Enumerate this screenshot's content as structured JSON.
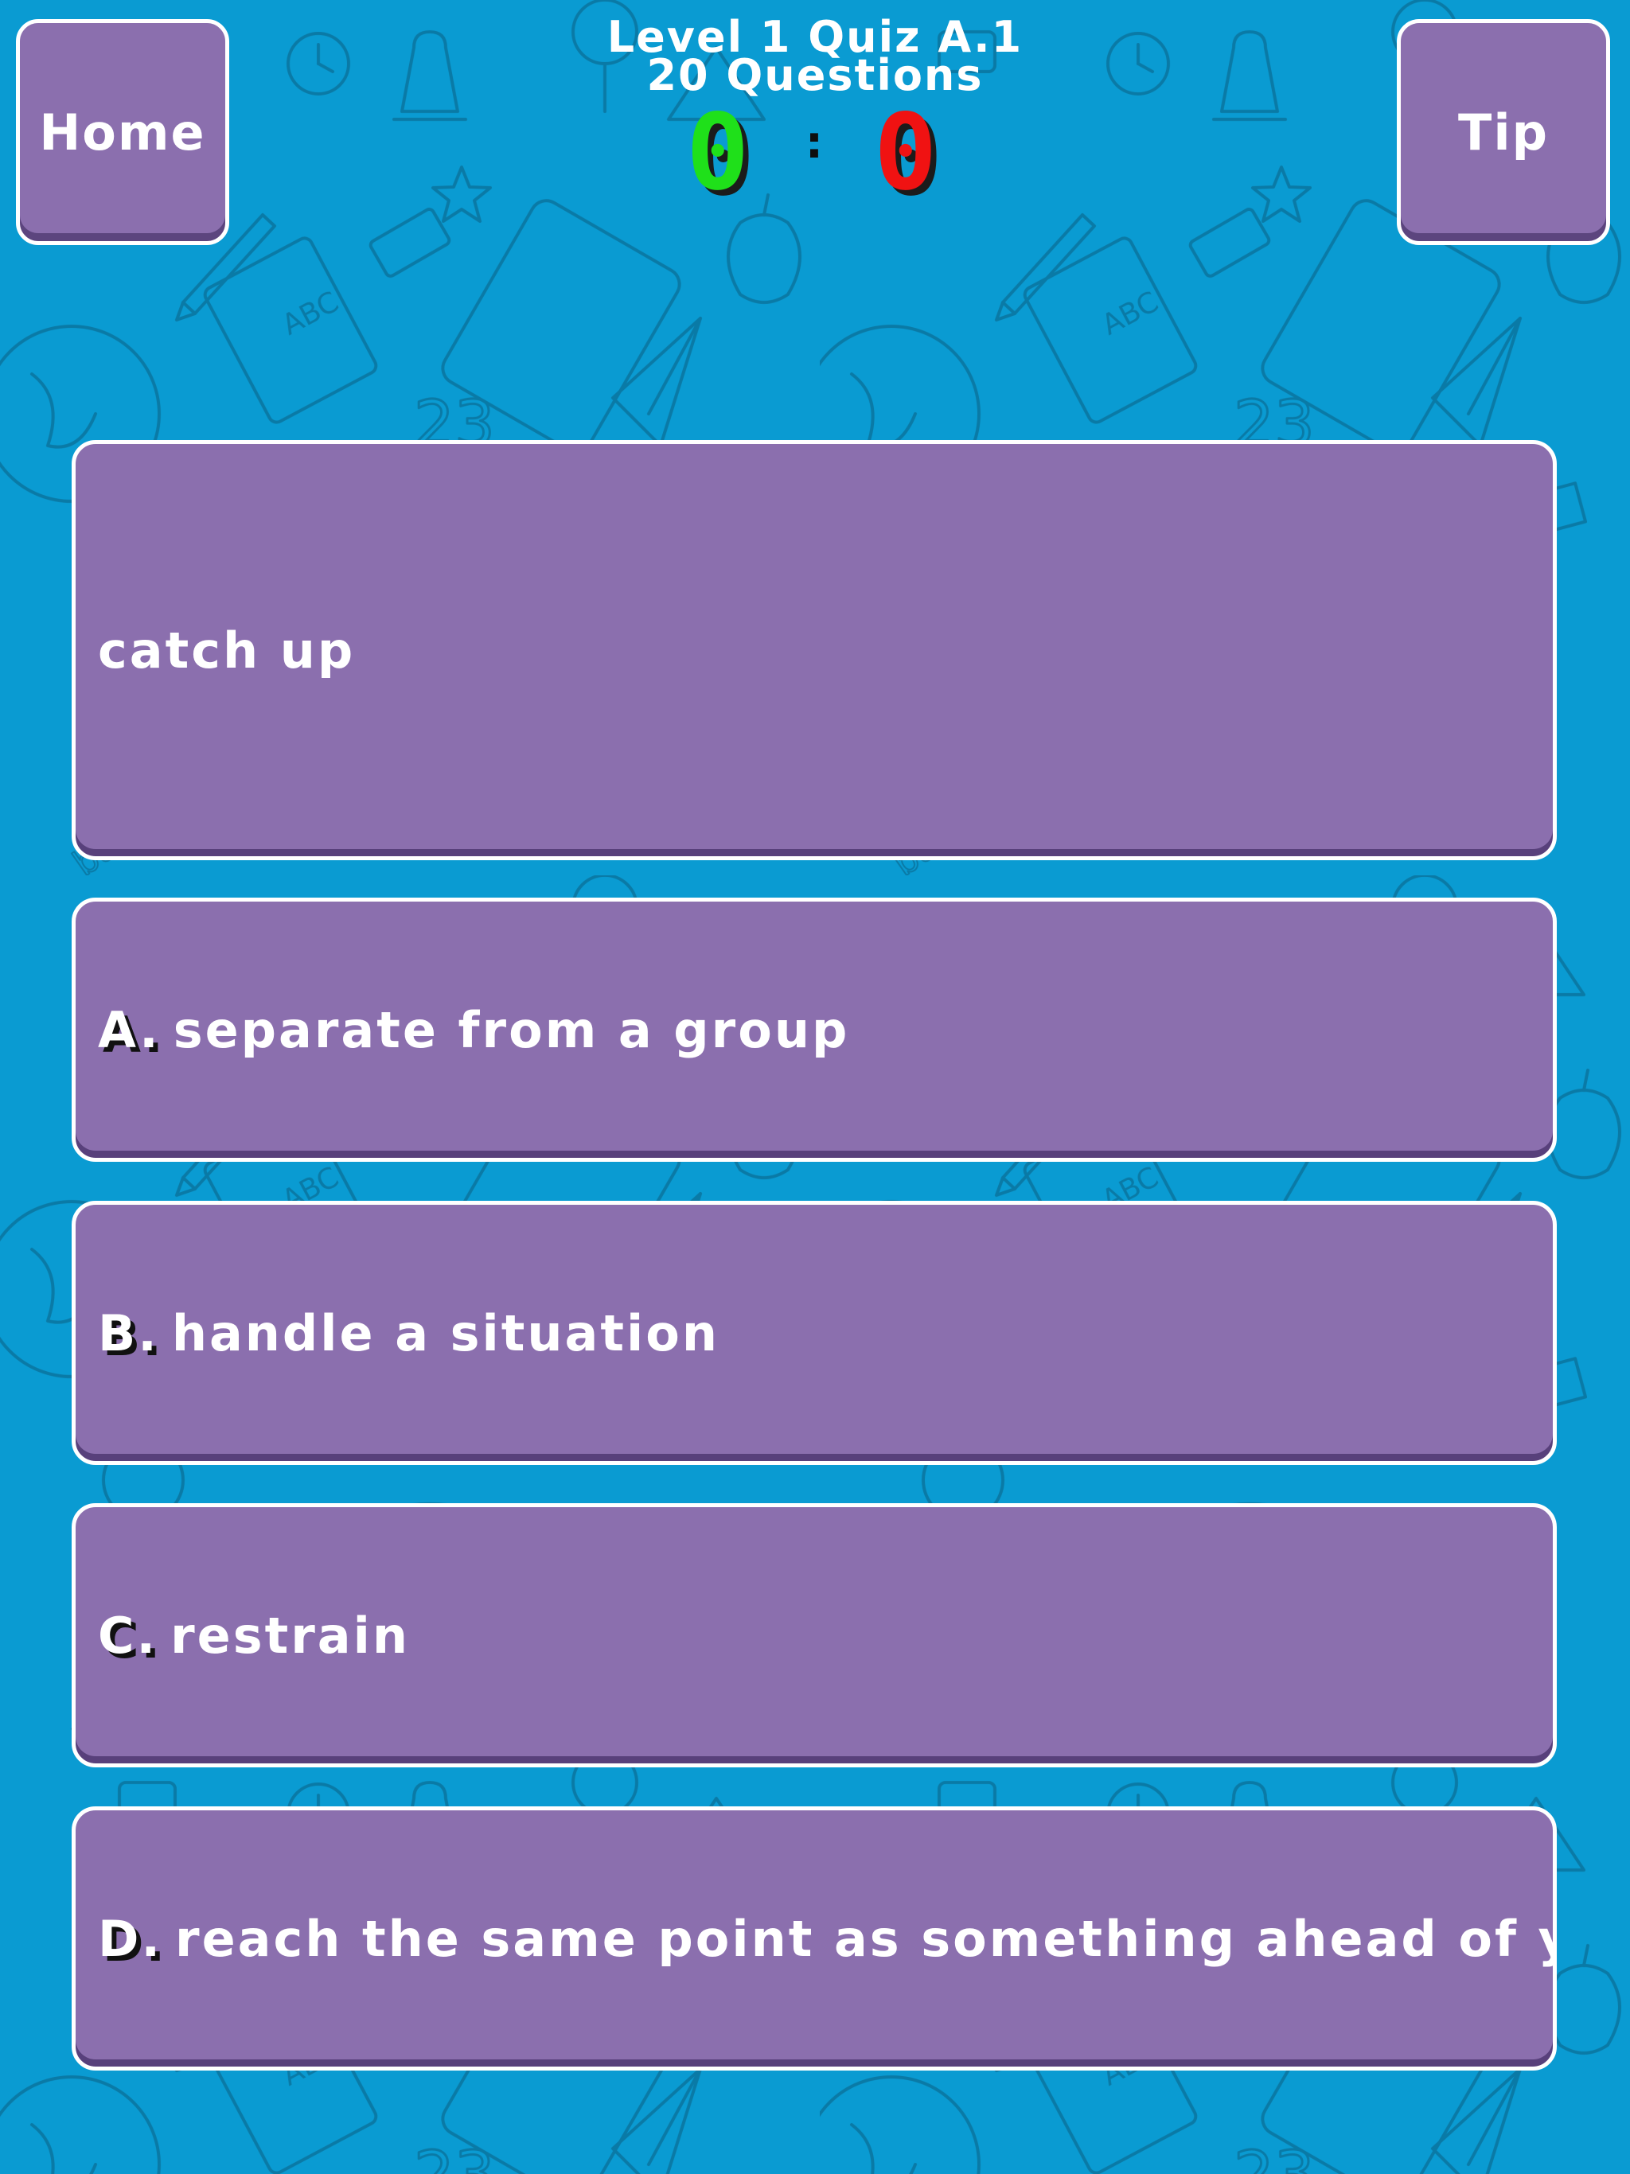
{
  "header": {
    "home_label": "Home",
    "tip_label": "Tip",
    "title_line1": "Level 1 Quiz A.1",
    "title_line2": "20 Questions"
  },
  "score": {
    "correct": "0",
    "separator": ":",
    "wrong": "0",
    "correct_color": "#1fe01a",
    "wrong_color": "#f01212"
  },
  "question": {
    "text": "catch up"
  },
  "answers": [
    {
      "letter": "A.",
      "text": "separate from a group"
    },
    {
      "letter": "B.",
      "text": "handle a situation"
    },
    {
      "letter": "C.",
      "text": "restrain"
    },
    {
      "letter": "D.",
      "text": "reach the same point as something ahead of you"
    }
  ],
  "colors": {
    "background": "#0a9bd2",
    "card": "#8b6fae",
    "card_border": "#ffffff",
    "text": "#ffffff"
  }
}
